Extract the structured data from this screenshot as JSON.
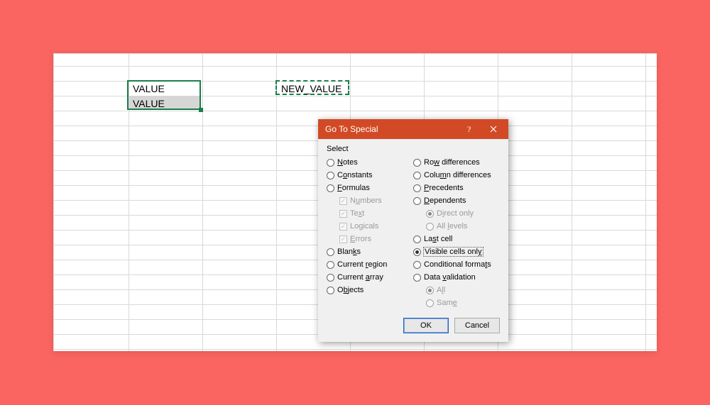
{
  "colors": {
    "page_bg": "#fa6461",
    "accent": "#d24a25",
    "selection_border": "#1a7e4b"
  },
  "sheet": {
    "cells": {
      "b2": "VALUE",
      "b3": "VALUE",
      "d2": "NEW_VALUE"
    }
  },
  "dialog": {
    "title": "Go To Special",
    "section_label": "Select",
    "options_left": [
      {
        "key": "notes",
        "pre": "",
        "u": "N",
        "post": "otes",
        "type": "radio",
        "selected": false
      },
      {
        "key": "constants",
        "pre": "C",
        "u": "o",
        "post": "nstants",
        "type": "radio",
        "selected": false
      },
      {
        "key": "formulas",
        "pre": "",
        "u": "F",
        "post": "ormulas",
        "type": "radio",
        "selected": false
      },
      {
        "key": "numbers",
        "pre": "N",
        "u": "u",
        "post": "mbers",
        "type": "check",
        "indent": true,
        "checked": true,
        "disabled": true
      },
      {
        "key": "text",
        "pre": "Te",
        "u": "x",
        "post": "t",
        "type": "check",
        "indent": true,
        "checked": true,
        "disabled": true
      },
      {
        "key": "logicals",
        "pre": "Lo",
        "u": "g",
        "post": "icals",
        "type": "check",
        "indent": true,
        "checked": true,
        "disabled": true
      },
      {
        "key": "errors",
        "pre": "",
        "u": "E",
        "post": "rrors",
        "type": "check",
        "indent": true,
        "checked": true,
        "disabled": true
      },
      {
        "key": "blanks",
        "pre": "Blan",
        "u": "k",
        "post": "s",
        "type": "radio",
        "selected": false
      },
      {
        "key": "current_region",
        "pre": "Current ",
        "u": "r",
        "post": "egion",
        "type": "radio",
        "selected": false
      },
      {
        "key": "current_array",
        "pre": "Current ",
        "u": "a",
        "post": "rray",
        "type": "radio",
        "selected": false
      },
      {
        "key": "objects",
        "pre": "O",
        "u": "b",
        "post": "jects",
        "type": "radio",
        "selected": false
      }
    ],
    "options_right": [
      {
        "key": "row_differences",
        "pre": "Ro",
        "u": "w",
        "post": " differences",
        "type": "radio",
        "selected": false
      },
      {
        "key": "column_differences",
        "pre": "Colu",
        "u": "m",
        "post": "n differences",
        "type": "radio",
        "selected": false
      },
      {
        "key": "precedents",
        "pre": "",
        "u": "P",
        "post": "recedents",
        "type": "radio",
        "selected": false
      },
      {
        "key": "dependents",
        "pre": "",
        "u": "D",
        "post": "ependents",
        "type": "radio",
        "selected": false
      },
      {
        "key": "direct_only",
        "pre": "D",
        "u": "i",
        "post": "rect only",
        "type": "radio",
        "indent": true,
        "selected": true,
        "disabled": true
      },
      {
        "key": "all_levels",
        "pre": "All ",
        "u": "l",
        "post": "evels",
        "type": "radio",
        "indent": true,
        "selected": false,
        "disabled": true
      },
      {
        "key": "last_cell",
        "pre": "La",
        "u": "s",
        "post": "t cell",
        "type": "radio",
        "selected": false
      },
      {
        "key": "visible_cells_only",
        "pre": "Visible cells onl",
        "u": "y",
        "post": "",
        "type": "radio",
        "selected": true,
        "focused": true
      },
      {
        "key": "conditional_formats",
        "pre": "Conditional forma",
        "u": "t",
        "post": "s",
        "type": "radio",
        "selected": false
      },
      {
        "key": "data_validation",
        "pre": "Data ",
        "u": "v",
        "post": "alidation",
        "type": "radio",
        "selected": false
      },
      {
        "key": "all",
        "pre": "A",
        "u": "l",
        "post": "l",
        "type": "radio",
        "indent": true,
        "selected": true,
        "disabled": true
      },
      {
        "key": "same",
        "pre": "Sam",
        "u": "e",
        "post": "",
        "type": "radio",
        "indent": true,
        "selected": false,
        "disabled": true
      }
    ],
    "ok_label": "OK",
    "cancel_label": "Cancel"
  }
}
